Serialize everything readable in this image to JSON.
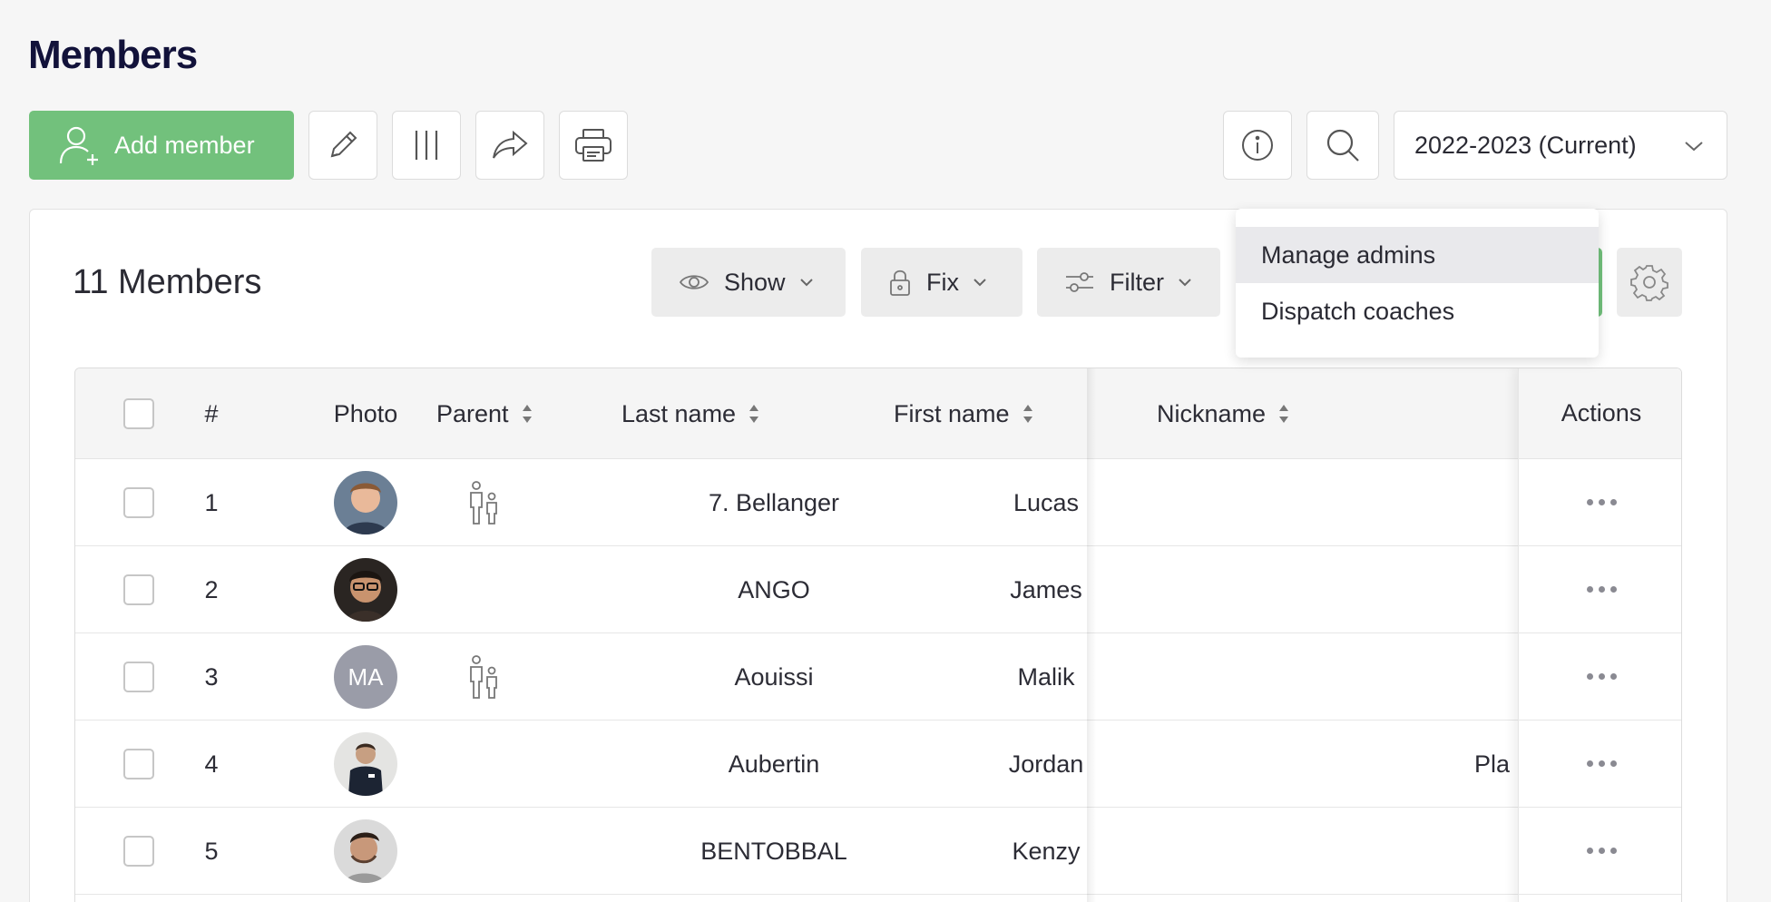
{
  "page": {
    "title": "Members"
  },
  "toolbar": {
    "add_member_label": "Add member",
    "season_selected": "2022-2023 (Current)"
  },
  "card": {
    "members_count": "11 Members"
  },
  "filters": {
    "show_label": "Show",
    "fix_label": "Fix",
    "filter_label": "Filter"
  },
  "dropdown": {
    "items": [
      {
        "label": "Manage admins",
        "active": true
      },
      {
        "label": "Dispatch coaches",
        "active": false
      }
    ]
  },
  "table": {
    "columns": {
      "number": "#",
      "photo": "Photo",
      "parent": "Parent",
      "last_name": "Last name",
      "first_name": "First name",
      "nickname": "Nickname",
      "actions": "Actions"
    },
    "rows": [
      {
        "number": "1",
        "last_name": "7. Bellanger",
        "first_name": "Lucas",
        "nickname": "",
        "parent": true,
        "avatar": "photo",
        "initials": ""
      },
      {
        "number": "2",
        "last_name": "ANGO",
        "first_name": "James",
        "nickname": "",
        "parent": false,
        "avatar": "photo",
        "initials": ""
      },
      {
        "number": "3",
        "last_name": "Aouissi",
        "first_name": "Malik",
        "nickname": "",
        "parent": true,
        "avatar": "initials",
        "initials": "MA"
      },
      {
        "number": "4",
        "last_name": "Aubertin",
        "first_name": "Jordan",
        "nickname": "Pla",
        "parent": false,
        "avatar": "photo",
        "initials": ""
      },
      {
        "number": "5",
        "last_name": "BENTOBBAL",
        "first_name": "Kenzy",
        "nickname": "",
        "parent": false,
        "avatar": "photo",
        "initials": ""
      }
    ]
  },
  "colors": {
    "accent_green": "#72c17c",
    "title_navy": "#12123a"
  }
}
